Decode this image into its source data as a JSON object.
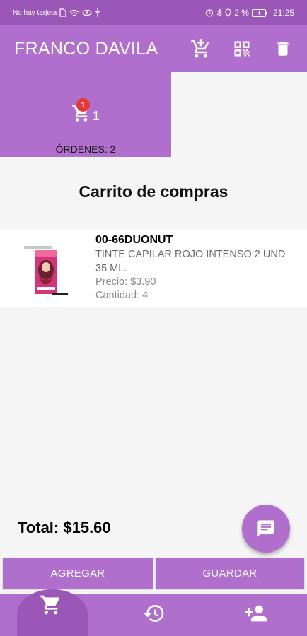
{
  "status_bar": {
    "carrier": "No hay tarjeta",
    "battery": "2 %",
    "time": "21:25"
  },
  "app_bar": {
    "title": "FRANCO DAVILA",
    "actions": [
      "add-shopping-cart-icon",
      "qr-code-icon",
      "delete-icon"
    ]
  },
  "orders": {
    "badge": "1",
    "count": "1",
    "label": "ÓRDENES: 2"
  },
  "section_title": "Carrito de compras",
  "cart_items": [
    {
      "code": "00-66DUONUT",
      "description": "TINTE CAPILAR ROJO INTENSO 2 UND 35 ML.",
      "price": "Precio: $3.90",
      "quantity": "Cantidad: 4"
    }
  ],
  "total": "Total: $15.60",
  "buttons": {
    "add": "AGREGAR",
    "save": "GUARDAR"
  },
  "bottom_nav": [
    "shopping-cart-icon",
    "history-icon",
    "person-add-icon"
  ],
  "colors": {
    "primary": "#b06fcc",
    "primary_dark": "#9a57b8",
    "badge": "#e53935"
  }
}
